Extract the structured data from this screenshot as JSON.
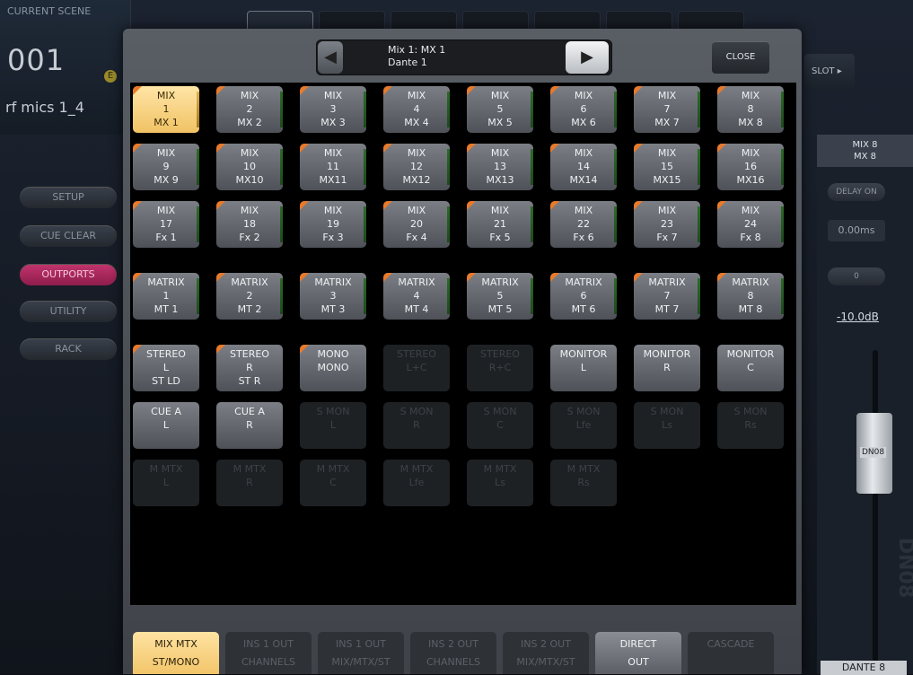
{
  "scene": {
    "label": "CURRENT SCENE",
    "number": "001",
    "badge": "E",
    "name": "rf mics 1_4"
  },
  "side_buttons": [
    "SETUP",
    "CUE CLEAR",
    "OUTPORTS",
    "UTILITY",
    "RACK"
  ],
  "slot_label": "SLOT ▸",
  "channel_strip": {
    "name_line1": "MIX 8",
    "name_line2": "MX 8",
    "delay_button": "DELAY ON",
    "delay_value": "0.00ms",
    "phase_value": "0",
    "level": "-10.0dB",
    "fader_label": "DN08",
    "bottom_name": "DANTE 8",
    "vertical_label": "DN08"
  },
  "popup": {
    "selector_line1": "Mix 1: MX 1",
    "selector_line2": "Dante 1",
    "close_label": "CLOSE",
    "cells": [
      [
        "MIX",
        "1",
        "MX 1"
      ],
      [
        "MIX",
        "2",
        "MX 2"
      ],
      [
        "MIX",
        "3",
        "MX 3"
      ],
      [
        "MIX",
        "4",
        "MX 4"
      ],
      [
        "MIX",
        "5",
        "MX 5"
      ],
      [
        "MIX",
        "6",
        "MX 6"
      ],
      [
        "MIX",
        "7",
        "MX 7"
      ],
      [
        "MIX",
        "8",
        "MX 8"
      ],
      [
        "MIX",
        "9",
        "MX 9"
      ],
      [
        "MIX",
        "10",
        "MX10"
      ],
      [
        "MIX",
        "11",
        "MX11"
      ],
      [
        "MIX",
        "12",
        "MX12"
      ],
      [
        "MIX",
        "13",
        "MX13"
      ],
      [
        "MIX",
        "14",
        "MX14"
      ],
      [
        "MIX",
        "15",
        "MX15"
      ],
      [
        "MIX",
        "16",
        "MX16"
      ],
      [
        "MIX",
        "17",
        "Fx 1"
      ],
      [
        "MIX",
        "18",
        "Fx 2"
      ],
      [
        "MIX",
        "19",
        "Fx 3"
      ],
      [
        "MIX",
        "20",
        "Fx 4"
      ],
      [
        "MIX",
        "21",
        "Fx 5"
      ],
      [
        "MIX",
        "22",
        "Fx 6"
      ],
      [
        "MIX",
        "23",
        "Fx 7"
      ],
      [
        "MIX",
        "24",
        "Fx 8"
      ],
      [
        "MATRIX",
        "1",
        "MT 1"
      ],
      [
        "MATRIX",
        "2",
        "MT 2"
      ],
      [
        "MATRIX",
        "3",
        "MT 3"
      ],
      [
        "MATRIX",
        "4",
        "MT 4"
      ],
      [
        "MATRIX",
        "5",
        "MT 5"
      ],
      [
        "MATRIX",
        "6",
        "MT 6"
      ],
      [
        "MATRIX",
        "7",
        "MT 7"
      ],
      [
        "MATRIX",
        "8",
        "MT 8"
      ],
      [
        "STEREO",
        "L",
        "ST LD"
      ],
      [
        "STEREO",
        "R",
        "ST R"
      ],
      [
        "MONO",
        "",
        "MONO"
      ],
      [
        "STEREO",
        "L+C",
        ""
      ],
      [
        "STEREO",
        "R+C",
        ""
      ],
      [
        "MONITOR",
        "L",
        ""
      ],
      [
        "MONITOR",
        "R",
        ""
      ],
      [
        "MONITOR",
        "C",
        ""
      ],
      [
        "CUE A",
        "L",
        ""
      ],
      [
        "CUE A",
        "R",
        ""
      ],
      [
        "S MON",
        "L",
        ""
      ],
      [
        "S MON",
        "R",
        ""
      ],
      [
        "S MON",
        "C",
        ""
      ],
      [
        "S MON",
        "Lfe",
        ""
      ],
      [
        "S MON",
        "Ls",
        ""
      ],
      [
        "S MON",
        "Rs",
        ""
      ],
      [
        "M MTX",
        "L",
        ""
      ],
      [
        "M MTX",
        "R",
        ""
      ],
      [
        "M MTX",
        "C",
        ""
      ],
      [
        "M MTX",
        "Lfe",
        ""
      ],
      [
        "M MTX",
        "Ls",
        ""
      ],
      [
        "M MTX",
        "Rs",
        ""
      ]
    ],
    "tabs": [
      [
        "MIX MTX",
        "ST/MONO"
      ],
      [
        "INS 1 OUT",
        "CHANNELS"
      ],
      [
        "INS 1 OUT",
        "MIX/MTX/ST"
      ],
      [
        "INS 2 OUT",
        "CHANNELS"
      ],
      [
        "INS 2 OUT",
        "MIX/MTX/ST"
      ],
      [
        "DIRECT",
        "OUT"
      ],
      [
        "CASCADE",
        ""
      ]
    ]
  }
}
